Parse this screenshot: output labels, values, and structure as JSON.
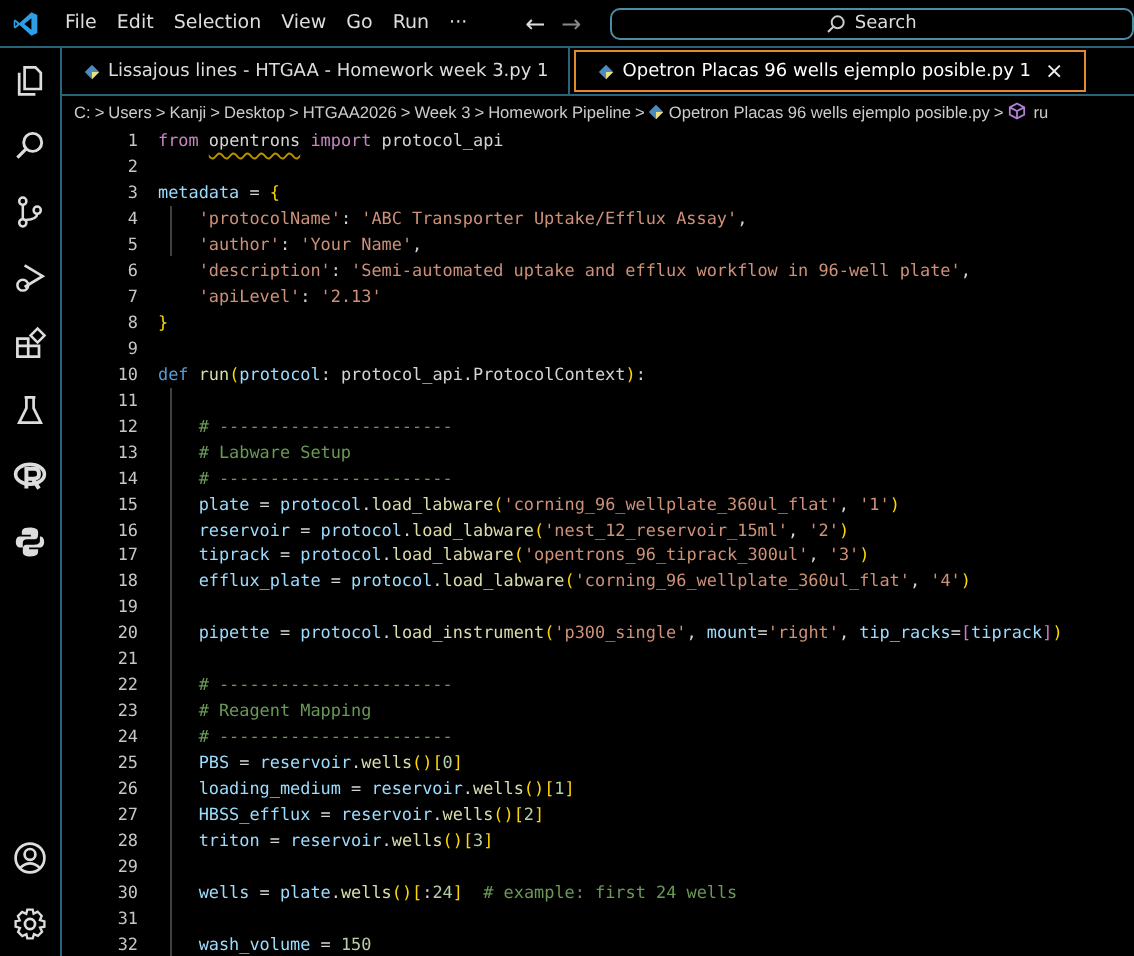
{
  "menu": [
    "File",
    "Edit",
    "Selection",
    "View",
    "Go",
    "Run",
    "···"
  ],
  "nav": {
    "back": "←",
    "forward": "→"
  },
  "search": {
    "placeholder": "Search"
  },
  "tabs": [
    {
      "label": "Lissajous lines - HTGAA - Homework week 3.py 1",
      "selected": false
    },
    {
      "label": "Opetron Placas 96 wells ejemplo posible.py 1",
      "selected": true,
      "close": "×"
    }
  ],
  "breadcrumb": [
    {
      "text": "C:",
      "kind": "folder"
    },
    {
      "text": "Users",
      "kind": "folder"
    },
    {
      "text": "Kanji",
      "kind": "folder"
    },
    {
      "text": "Desktop",
      "kind": "folder"
    },
    {
      "text": "HTGAA2026",
      "kind": "folder"
    },
    {
      "text": "Week 3",
      "kind": "folder"
    },
    {
      "text": "Homework Pipeline",
      "kind": "folder"
    },
    {
      "text": "Opetron Placas 96 wells ejemplo posible.py",
      "kind": "file"
    },
    {
      "text": "ru",
      "kind": "symbol"
    }
  ],
  "breadcrumb_separator": ">",
  "lines": [
    {
      "number": "1",
      "tokens": [
        {
          "kind": "kw",
          "text": "from "
        },
        {
          "kind": "warn",
          "text": "opentrons"
        },
        {
          "kind": "kw",
          "text": " import"
        },
        {
          "kind": "plain",
          "text": " protocol_api"
        }
      ]
    },
    {
      "number": "2"
    },
    {
      "number": "3",
      "tokens": [
        {
          "kind": "var",
          "text": "metadata"
        },
        {
          "kind": "plain",
          "text": " = "
        },
        {
          "kind": "b1",
          "text": "{"
        }
      ]
    },
    {
      "number": "4",
      "tokens": [
        {
          "kind": "str",
          "text": "    'protocolName'"
        },
        {
          "kind": "plain",
          "text": ": "
        },
        {
          "kind": "str",
          "text": "'ABC Transporter Uptake/Efflux Assay'"
        },
        {
          "kind": "plain",
          "text": ","
        }
      ]
    },
    {
      "number": "5",
      "tokens": [
        {
          "kind": "str",
          "text": "    'author'"
        },
        {
          "kind": "plain",
          "text": ": "
        },
        {
          "kind": "str",
          "text": "'Your Name'"
        },
        {
          "kind": "plain",
          "text": ","
        }
      ]
    },
    {
      "number": "6",
      "tokens": [
        {
          "kind": "str",
          "text": "    'description'"
        },
        {
          "kind": "plain",
          "text": ": "
        },
        {
          "kind": "str",
          "text": "'Semi-automated uptake and efflux workflow in 96-well plate'"
        },
        {
          "kind": "plain",
          "text": ","
        }
      ]
    },
    {
      "number": "7",
      "tokens": [
        {
          "kind": "str",
          "text": "    'apiLevel'"
        },
        {
          "kind": "plain",
          "text": ": "
        },
        {
          "kind": "str",
          "text": "'2.13'"
        }
      ]
    },
    {
      "number": "8",
      "tokens": [
        {
          "kind": "b1",
          "text": "}"
        }
      ]
    },
    {
      "number": "9"
    },
    {
      "number": "10",
      "tokens": [
        {
          "kind": "def",
          "text": "def "
        },
        {
          "kind": "fn",
          "text": "run"
        },
        {
          "kind": "b1",
          "text": "("
        },
        {
          "kind": "var",
          "text": "protocol"
        },
        {
          "kind": "plain",
          "text": ": protocol_api.ProtocolContext"
        },
        {
          "kind": "b1",
          "text": ")"
        },
        {
          "kind": "plain",
          "text": ":"
        }
      ]
    },
    {
      "number": "11"
    },
    {
      "number": "12",
      "tokens": [
        {
          "kind": "cmt",
          "text": "    # -----------------------"
        }
      ]
    },
    {
      "number": "13",
      "tokens": [
        {
          "kind": "cmt",
          "text": "    # Labware Setup"
        }
      ]
    },
    {
      "number": "14",
      "tokens": [
        {
          "kind": "cmt",
          "text": "    # -----------------------"
        }
      ]
    },
    {
      "number": "15",
      "tokens": [
        {
          "kind": "var",
          "text": "    plate"
        },
        {
          "kind": "plain",
          "text": " = "
        },
        {
          "kind": "var",
          "text": "protocol"
        },
        {
          "kind": "plain",
          "text": "."
        },
        {
          "kind": "fn",
          "text": "load_labware"
        },
        {
          "kind": "b1",
          "text": "("
        },
        {
          "kind": "str",
          "text": "'corning_96_wellplate_360ul_flat'"
        },
        {
          "kind": "plain",
          "text": ", "
        },
        {
          "kind": "str",
          "text": "'1'"
        },
        {
          "kind": "b1",
          "text": ")"
        }
      ]
    },
    {
      "number": "16",
      "tokens": [
        {
          "kind": "var",
          "text": "    reservoir"
        },
        {
          "kind": "plain",
          "text": " = "
        },
        {
          "kind": "var",
          "text": "protocol"
        },
        {
          "kind": "plain",
          "text": "."
        },
        {
          "kind": "fn",
          "text": "load_labware"
        },
        {
          "kind": "b1",
          "text": "("
        },
        {
          "kind": "str",
          "text": "'nest_12_reservoir_15ml'"
        },
        {
          "kind": "plain",
          "text": ", "
        },
        {
          "kind": "str",
          "text": "'2'"
        },
        {
          "kind": "b1",
          "text": ")"
        }
      ]
    },
    {
      "number": "17",
      "tokens": [
        {
          "kind": "var",
          "text": "    tiprack"
        },
        {
          "kind": "plain",
          "text": " = "
        },
        {
          "kind": "var",
          "text": "protocol"
        },
        {
          "kind": "plain",
          "text": "."
        },
        {
          "kind": "fn",
          "text": "load_labware"
        },
        {
          "kind": "b1",
          "text": "("
        },
        {
          "kind": "str",
          "text": "'opentrons_96_tiprack_300ul'"
        },
        {
          "kind": "plain",
          "text": ", "
        },
        {
          "kind": "str",
          "text": "'3'"
        },
        {
          "kind": "b1",
          "text": ")"
        }
      ]
    },
    {
      "number": "18",
      "tokens": [
        {
          "kind": "var",
          "text": "    efflux_plate"
        },
        {
          "kind": "plain",
          "text": " = "
        },
        {
          "kind": "var",
          "text": "protocol"
        },
        {
          "kind": "plain",
          "text": "."
        },
        {
          "kind": "fn",
          "text": "load_labware"
        },
        {
          "kind": "b1",
          "text": "("
        },
        {
          "kind": "str",
          "text": "'corning_96_wellplate_360ul_flat'"
        },
        {
          "kind": "plain",
          "text": ", "
        },
        {
          "kind": "str",
          "text": "'4'"
        },
        {
          "kind": "b1",
          "text": ")"
        }
      ]
    },
    {
      "number": "19"
    },
    {
      "number": "20",
      "tokens": [
        {
          "kind": "var",
          "text": "    pipette"
        },
        {
          "kind": "plain",
          "text": " = "
        },
        {
          "kind": "var",
          "text": "protocol"
        },
        {
          "kind": "plain",
          "text": "."
        },
        {
          "kind": "fn",
          "text": "load_instrument"
        },
        {
          "kind": "b1",
          "text": "("
        },
        {
          "kind": "str",
          "text": "'p300_single'"
        },
        {
          "kind": "plain",
          "text": ", "
        },
        {
          "kind": "var",
          "text": "mount"
        },
        {
          "kind": "plain",
          "text": "="
        },
        {
          "kind": "str",
          "text": "'right'"
        },
        {
          "kind": "plain",
          "text": ", "
        },
        {
          "kind": "var",
          "text": "tip_racks"
        },
        {
          "kind": "plain",
          "text": "="
        },
        {
          "kind": "b2",
          "text": "["
        },
        {
          "kind": "var",
          "text": "tiprack"
        },
        {
          "kind": "b2",
          "text": "]"
        },
        {
          "kind": "b1",
          "text": ")"
        }
      ]
    },
    {
      "number": "21"
    },
    {
      "number": "22",
      "tokens": [
        {
          "kind": "cmt",
          "text": "    # -----------------------"
        }
      ]
    },
    {
      "number": "23",
      "tokens": [
        {
          "kind": "cmt",
          "text": "    # Reagent Mapping"
        }
      ]
    },
    {
      "number": "24",
      "tokens": [
        {
          "kind": "cmt",
          "text": "    # -----------------------"
        }
      ]
    },
    {
      "number": "25",
      "tokens": [
        {
          "kind": "var",
          "text": "    PBS"
        },
        {
          "kind": "plain",
          "text": " = "
        },
        {
          "kind": "var",
          "text": "reservoir"
        },
        {
          "kind": "plain",
          "text": "."
        },
        {
          "kind": "fn",
          "text": "wells"
        },
        {
          "kind": "b1",
          "text": "()["
        },
        {
          "kind": "num",
          "text": "0"
        },
        {
          "kind": "b1",
          "text": "]"
        }
      ]
    },
    {
      "number": "26",
      "tokens": [
        {
          "kind": "var",
          "text": "    loading_medium"
        },
        {
          "kind": "plain",
          "text": " = "
        },
        {
          "kind": "var",
          "text": "reservoir"
        },
        {
          "kind": "plain",
          "text": "."
        },
        {
          "kind": "fn",
          "text": "wells"
        },
        {
          "kind": "b1",
          "text": "()["
        },
        {
          "kind": "num",
          "text": "1"
        },
        {
          "kind": "b1",
          "text": "]"
        }
      ]
    },
    {
      "number": "27",
      "tokens": [
        {
          "kind": "var",
          "text": "    HBSS_efflux"
        },
        {
          "kind": "plain",
          "text": " = "
        },
        {
          "kind": "var",
          "text": "reservoir"
        },
        {
          "kind": "plain",
          "text": "."
        },
        {
          "kind": "fn",
          "text": "wells"
        },
        {
          "kind": "b1",
          "text": "()["
        },
        {
          "kind": "num",
          "text": "2"
        },
        {
          "kind": "b1",
          "text": "]"
        }
      ]
    },
    {
      "number": "28",
      "tokens": [
        {
          "kind": "var",
          "text": "    triton"
        },
        {
          "kind": "plain",
          "text": " = "
        },
        {
          "kind": "var",
          "text": "reservoir"
        },
        {
          "kind": "plain",
          "text": "."
        },
        {
          "kind": "fn",
          "text": "wells"
        },
        {
          "kind": "b1",
          "text": "()["
        },
        {
          "kind": "num",
          "text": "3"
        },
        {
          "kind": "b1",
          "text": "]"
        }
      ]
    },
    {
      "number": "29"
    },
    {
      "number": "30",
      "tokens": [
        {
          "kind": "var",
          "text": "    wells"
        },
        {
          "kind": "plain",
          "text": " = "
        },
        {
          "kind": "var",
          "text": "plate"
        },
        {
          "kind": "plain",
          "text": "."
        },
        {
          "kind": "fn",
          "text": "wells"
        },
        {
          "kind": "b1",
          "text": "()["
        },
        {
          "kind": "plain",
          "text": ":"
        },
        {
          "kind": "num",
          "text": "24"
        },
        {
          "kind": "b1",
          "text": "]  "
        },
        {
          "kind": "cmt",
          "text": "# example: first 24 wells"
        }
      ]
    },
    {
      "number": "31"
    },
    {
      "number": "32",
      "tokens": [
        {
          "kind": "var",
          "text": "    wash_volume"
        },
        {
          "kind": "plain",
          "text": " = "
        },
        {
          "kind": "num",
          "text": "150"
        }
      ]
    }
  ]
}
